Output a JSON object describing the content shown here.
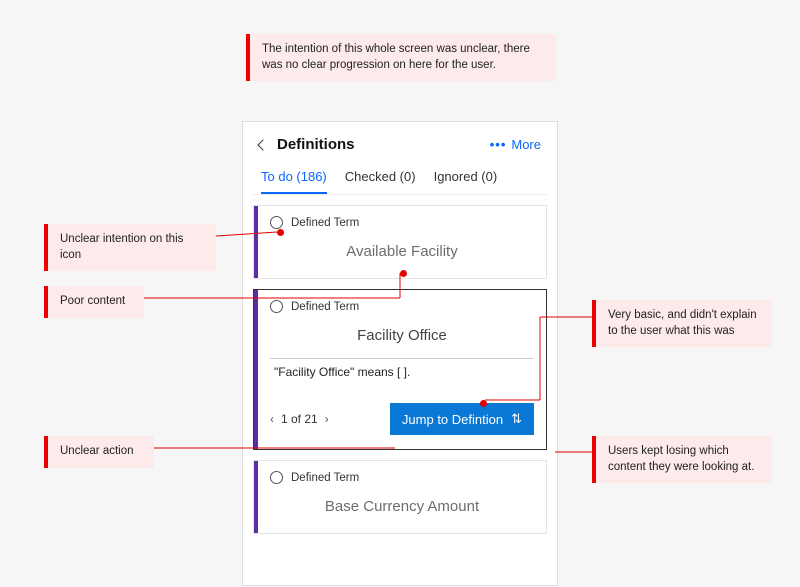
{
  "annotations": {
    "top": "The intention of this whole screen was unclear, there was no clear progression on here for the user.",
    "left1": "Unclear intention on this icon",
    "left2": "Poor content",
    "left3": "Unclear action",
    "right1": "Very basic, and didn't explain to the user what this was",
    "right2": "Users kept losing which content they were looking at."
  },
  "panel": {
    "title": "Definitions",
    "more_label": "More"
  },
  "tabs": {
    "todo": "To do (186)",
    "checked": "Checked (0)",
    "ignored": "Ignored (0)"
  },
  "cards": [
    {
      "type_label": "Defined Term",
      "term": "Available Facility"
    },
    {
      "type_label": "Defined Term",
      "term": "Facility Office",
      "definition": "\"Facility Office\" means [                               ].",
      "pager": "1 of 21",
      "jump_label": "Jump to Defintion"
    },
    {
      "type_label": "Defined Term",
      "term": "Base Currency Amount"
    }
  ]
}
